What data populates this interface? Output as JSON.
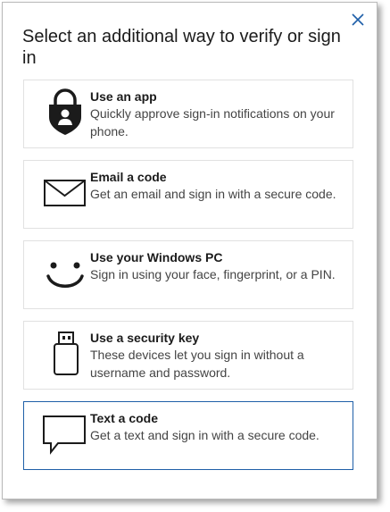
{
  "dialog": {
    "title": "Select an additional way to verify or sign in",
    "close_icon": "close-icon"
  },
  "options": [
    {
      "title": "Use an app",
      "description": "Quickly approve sign-in notifications on your phone.",
      "icon": "authenticator-lock-icon"
    },
    {
      "title": "Email a code",
      "description": "Get an email and sign in with a secure code.",
      "icon": "envelope-icon"
    },
    {
      "title": "Use your Windows PC",
      "description": "Sign in using your face, fingerprint, or a PIN.",
      "icon": "smiley-face-icon"
    },
    {
      "title": "Use a security key",
      "description": "These devices let you sign in without a username and password.",
      "icon": "usb-key-icon"
    },
    {
      "title": "Text a code",
      "description": "Get a text and sign in with a secure code.",
      "icon": "speech-bubble-icon",
      "selected": true
    }
  ],
  "colors": {
    "selected_border": "#1f5fa8",
    "close_icon": "#1f5fa8"
  }
}
